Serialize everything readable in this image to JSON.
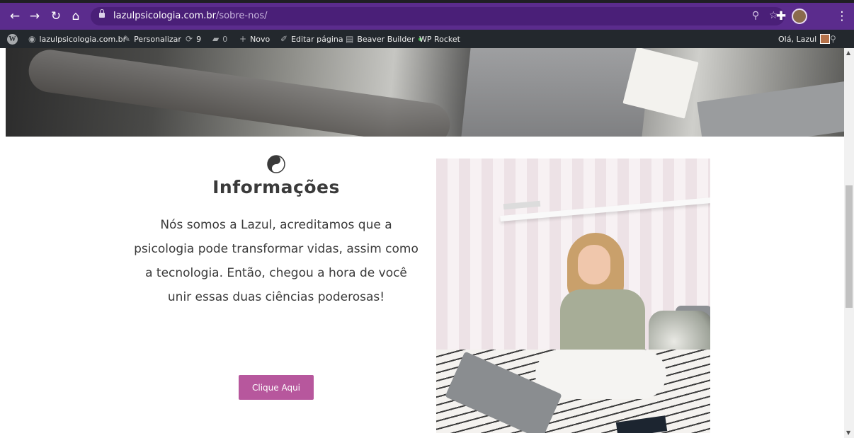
{
  "browser": {
    "url_host": "lazulpsicologia.com.br",
    "url_path": "/sobre-nos/",
    "colors": {
      "toolbar": "#5b2c8d",
      "omnibox": "#4a1f78"
    }
  },
  "adminbar": {
    "site_name": "lazulpsicologia.com.br",
    "customize": "Personalizar",
    "updates_count": "9",
    "comments_count": "0",
    "new": "Novo",
    "edit_page": "Editar página",
    "beaver_builder": "Beaver Builder",
    "wp_rocket": "WP Rocket",
    "greeting": "Olá, Lazul"
  },
  "section": {
    "heading": "Informações",
    "body": "Nós somos a Lazul, acreditamos que a psicologia pode transformar vidas, assim como a tecnologia. Então, chegou a hora de você unir essas duas ciências poderosas!",
    "cta_label": "Clique Aqui",
    "accent_color": "#b7579d"
  }
}
